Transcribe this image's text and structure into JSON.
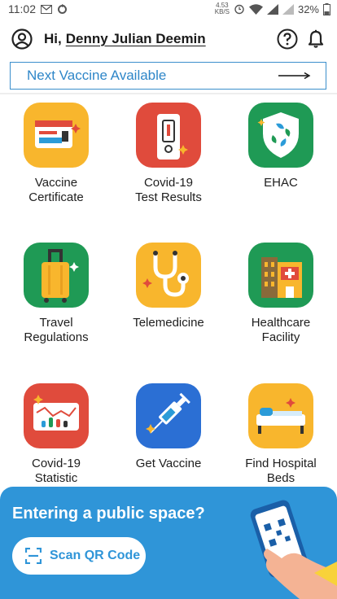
{
  "status_bar": {
    "time": "11:02",
    "net_speed": "4.53",
    "net_unit": "KB/S",
    "battery": "32%",
    "icons": [
      "gmail-icon",
      "sync-icon",
      "alarm-icon",
      "wifi-icon",
      "signal-icon",
      "battery-icon"
    ]
  },
  "header": {
    "greeting": "Hi,",
    "user_name": "Denny Julian Deemin",
    "icons": [
      "profile-icon",
      "help-icon",
      "bell-icon"
    ]
  },
  "banner": {
    "label": "Next Vaccine Available"
  },
  "menu": [
    {
      "label": "Vaccine\nCertificate",
      "icon": "certificate-icon",
      "color": "#f8b62d"
    },
    {
      "label": "Covid-19\nTest Results",
      "icon": "test-kit-icon",
      "color": "#e04b3c"
    },
    {
      "label": "EHAC",
      "icon": "shield-icon",
      "color": "#1f9a55"
    },
    {
      "label": "Travel\nRegulations",
      "icon": "luggage-icon",
      "color": "#1f9a55"
    },
    {
      "label": "Telemedicine",
      "icon": "stethoscope-icon",
      "color": "#f8b62d"
    },
    {
      "label": "Healthcare\nFacility",
      "icon": "hospital-icon",
      "color": "#1f9a55"
    },
    {
      "label": "Covid-19\nStatistic",
      "icon": "statistics-icon",
      "color": "#e04b3c"
    },
    {
      "label": "Get Vaccine",
      "icon": "syringe-icon",
      "color": "#2b6fd4"
    },
    {
      "label": "Find Hospital\nBeds",
      "icon": "hospital-bed-icon",
      "color": "#f8b62d"
    }
  ],
  "scan_panel": {
    "title": "Entering a public space?",
    "button_label": "Scan QR Code",
    "colors": {
      "panel": "#2f95d8",
      "button_text": "#2f95d8"
    }
  }
}
